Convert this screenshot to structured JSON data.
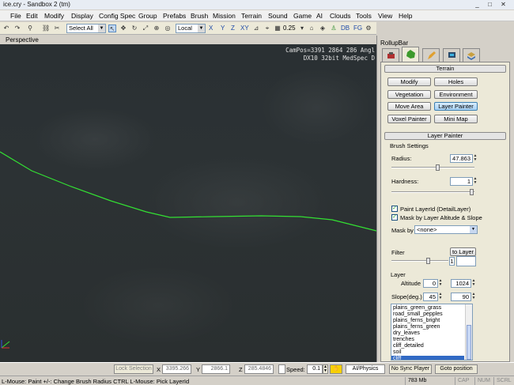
{
  "window": {
    "title": "ice.cry - Sandbox 2 (tm)",
    "minimize": "_",
    "maximize": "□",
    "close": "✕"
  },
  "menu": [
    "File",
    "Edit",
    "Modify",
    "Display",
    "Config Spec",
    "Group",
    "Prefabs",
    "Brush",
    "Mission",
    "Terrain",
    "Sound",
    "Game",
    "AI",
    "Clouds",
    "Tools",
    "View",
    "Help"
  ],
  "toolbar": {
    "selection_set": "Select All",
    "coord_system": "Local",
    "axes": [
      "X",
      "Y",
      "Z",
      "XY"
    ],
    "grid_size": "0.25",
    "right_icons": [
      "DB",
      "FG"
    ]
  },
  "viewport": {
    "tab_label": "Perspective",
    "info_line1": "CamPos=3391  2864  286 Angl",
    "info_line2": "DX10 32bit MedSpec D"
  },
  "rollup": {
    "title": "RollupBar",
    "terrain_section": "Terrain",
    "buttons": [
      "Modify",
      "Holes",
      "Vegetation",
      "Environment",
      "Move Area",
      "Layer Painter",
      "Voxel Painter",
      "Mini Map"
    ],
    "active_button": "Layer Painter",
    "layer_painter_section": "Layer Painter",
    "brush_settings_label": "Brush Settings",
    "radius_label": "Radius:",
    "radius_value": "47.863",
    "hardness_label": "Hardness:",
    "hardness_value": "1",
    "paint_layerid_label": "Paint LayerId (DetailLayer)",
    "paint_layerid_checked": true,
    "mask_altitude_label": "Mask by Layer Altitude & Slope",
    "mask_altitude_checked": true,
    "mask_by_label": "Mask by",
    "mask_by_value": "<none>",
    "filter_label": "Filter",
    "to_layer_label": "to Layer",
    "filter_value": "1",
    "layer_label": "Layer",
    "altitude_label": "Altitude",
    "altitude_min": "0",
    "altitude_max": "1024",
    "slope_label": "Slope(deg.)",
    "slope_min": "45",
    "slope_max": "90",
    "layers": [
      "plains_green_grass",
      "road_small_pepples",
      "plains_ferns_bright",
      "plains_ferns_green",
      "dry_leaves",
      "trenches",
      "cliff_detailed",
      "soil",
      "cliff"
    ],
    "selected_layer": "cliff"
  },
  "status_row": {
    "lock_selection": "Lock Selection",
    "x_label": "X",
    "x_value": "3395.266",
    "y_label": "Y",
    "y_value": "2866.1",
    "z_label": "Z",
    "z_value": "285.4846",
    "speed_label": "Speed:",
    "speed_value": "0.1",
    "ai_physics": "AI/Physics",
    "no_sync_player": "No Sync Player",
    "goto_position": "Goto position"
  },
  "status_bar": {
    "hint": "L-Mouse: Paint   +/-: Change Brush Radius   CTRL L-Mouse: Pick LayerId",
    "memory": "783 Mb",
    "cap": "CAP",
    "num": "NUM",
    "scrl": "SCRL"
  },
  "colors": {
    "path_line": "#33e033",
    "selection_blue": "#316ac5",
    "active_button": "#a6d0f4"
  }
}
